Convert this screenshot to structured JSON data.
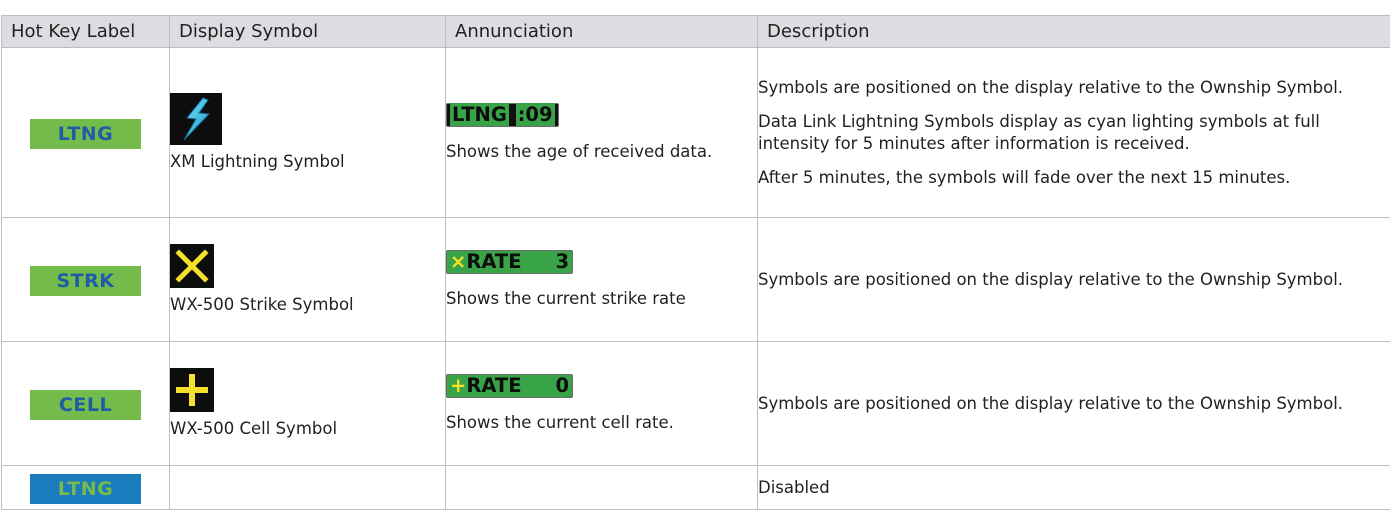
{
  "headers": {
    "hotkey": "Hot Key Label",
    "symbol": "Display Symbol",
    "annunciation": "Annunciation",
    "description": "Description"
  },
  "rows": [
    {
      "hotkey": "LTNG",
      "hotkey_style": "green",
      "symbol_icon": "lightning-bolt-icon",
      "symbol_caption": "XM Lightning Symbol",
      "annunciation": {
        "label": "LTNG",
        "value": ":09"
      },
      "annunciation_caption": "Shows the age of received data.",
      "description": [
        "Symbols are positioned on the display relative to the Ownship Symbol.",
        "Data Link Lightning Symbols display as cyan lighting symbols at full intensity for 5 minutes after information is received.",
        "After 5 minutes, the symbols will fade over the next 15 minutes."
      ]
    },
    {
      "hotkey": "STRK",
      "hotkey_style": "green",
      "symbol_icon": "strike-x-icon",
      "symbol_caption": "WX-500 Strike Symbol",
      "annunciation": {
        "icon": "×",
        "label": "RATE",
        "value": "3"
      },
      "annunciation_caption": "Shows the current strike rate",
      "description": [
        "Symbols are positioned on the display relative to the Ownship Symbol."
      ]
    },
    {
      "hotkey": "CELL",
      "hotkey_style": "green",
      "symbol_icon": "cell-plus-icon",
      "symbol_caption": "WX-500 Cell Symbol",
      "annunciation": {
        "icon": "+",
        "label": "RATE",
        "value": "0"
      },
      "annunciation_caption": "Shows the current cell rate.",
      "description": [
        "Symbols are positioned on the display relative to the Ownship Symbol."
      ]
    },
    {
      "hotkey": "LTNG",
      "hotkey_style": "blue",
      "description": [
        "Disabled"
      ]
    }
  ],
  "colors": {
    "hotkey_green_bg": "#73bc4b",
    "hotkey_green_text": "#1f5ca8",
    "hotkey_blue_bg": "#1a7bbd",
    "hotkey_blue_text": "#79bb4a",
    "lightning_cyan": "#29b6e8",
    "symbol_yellow": "#f5e12b",
    "annunciation_green": "#2ec654",
    "header_bg": "#dcdde0"
  }
}
